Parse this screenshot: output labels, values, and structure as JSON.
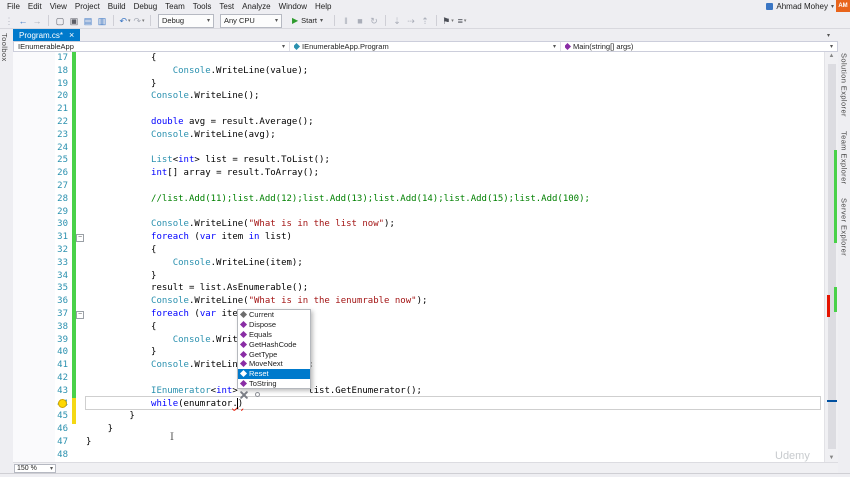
{
  "window": {
    "user": "Ahmad Mohey",
    "avatar_initials": "AM",
    "watermark": "Udemy"
  },
  "menu": {
    "items": [
      "File",
      "Edit",
      "View",
      "Project",
      "Build",
      "Debug",
      "Team",
      "Tools",
      "Test",
      "Analyze",
      "Window",
      "Help"
    ]
  },
  "toolbar": {
    "icons_left": [
      {
        "glyph": "⋮",
        "name": "toolbar-drag-handle-icon",
        "color": "#b0b3bd"
      },
      {
        "glyph": "←",
        "name": "navigate-backward-icon",
        "color": "#3a76c4"
      },
      {
        "glyph": "→",
        "name": "navigate-forward-icon",
        "color": "#a9adb8"
      },
      {
        "sep": true
      },
      {
        "glyph": "▢",
        "name": "new-file-icon",
        "color": "#5a5d66"
      },
      {
        "glyph": "▣",
        "name": "open-file-icon",
        "color": "#5a5d66"
      },
      {
        "glyph": "▤",
        "name": "save-icon",
        "color": "#3a76c4"
      },
      {
        "glyph": "▥",
        "name": "save-all-icon",
        "color": "#3a76c4"
      },
      {
        "sep": true
      },
      {
        "glyph": "↶",
        "name": "undo-icon",
        "color": "#3a76c4",
        "dd": true
      },
      {
        "glyph": "↷",
        "name": "redo-icon",
        "color": "#a9adb8",
        "dd": true
      },
      {
        "sep": true
      }
    ],
    "debug_config": "Debug",
    "platform": "Any CPU",
    "start_label": "Start",
    "icons_right": [
      {
        "sep": true
      },
      {
        "glyph": "‖",
        "name": "pause-icon",
        "color": "#a9adb8"
      },
      {
        "glyph": "■",
        "name": "stop-icon",
        "color": "#a9adb8"
      },
      {
        "glyph": "↻",
        "name": "restart-icon",
        "color": "#a9adb8"
      },
      {
        "sep": true
      },
      {
        "glyph": "⇣",
        "name": "step-into-icon",
        "color": "#a9adb8"
      },
      {
        "glyph": "⇢",
        "name": "step-over-icon",
        "color": "#a9adb8"
      },
      {
        "glyph": "⇡",
        "name": "step-out-icon",
        "color": "#a9adb8"
      },
      {
        "sep": true
      },
      {
        "glyph": "⚑",
        "name": "bookmark-icon",
        "color": "#4a4d55",
        "dd": true
      },
      {
        "glyph": "≡",
        "name": "text-options-icon",
        "color": "#4a4d55",
        "dd": true
      }
    ]
  },
  "tabs": [
    {
      "label": "Program.cs*"
    }
  ],
  "navbar": {
    "project": "IEnumerableApp",
    "type_name": "IEnumerableApp.Program",
    "member": "Main(string[] args)"
  },
  "editor": {
    "zoom": "150 %",
    "lines": [
      {
        "n": 17,
        "s": [
          [
            "p",
            "            {"
          ]
        ]
      },
      {
        "n": 18,
        "s": [
          [
            "p",
            "                "
          ],
          [
            "t",
            "Console"
          ],
          [
            "p",
            ".WriteLine(value);"
          ]
        ]
      },
      {
        "n": 19,
        "s": [
          [
            "p",
            "            }"
          ]
        ]
      },
      {
        "n": 20,
        "s": [
          [
            "p",
            "            "
          ],
          [
            "t",
            "Console"
          ],
          [
            "p",
            ".WriteLine();"
          ]
        ]
      },
      {
        "n": 21,
        "s": []
      },
      {
        "n": 22,
        "s": [
          [
            "p",
            "            "
          ],
          [
            "k",
            "double"
          ],
          [
            "p",
            " avg = result.Average();"
          ]
        ]
      },
      {
        "n": 23,
        "s": [
          [
            "p",
            "            "
          ],
          [
            "t",
            "Console"
          ],
          [
            "p",
            ".WriteLine(avg);"
          ]
        ]
      },
      {
        "n": 24,
        "s": []
      },
      {
        "n": 25,
        "s": [
          [
            "p",
            "            "
          ],
          [
            "t",
            "List"
          ],
          [
            "p",
            "<"
          ],
          [
            "k",
            "int"
          ],
          [
            "p",
            "> list = result.ToList();"
          ]
        ]
      },
      {
        "n": 26,
        "s": [
          [
            "p",
            "            "
          ],
          [
            "k",
            "int"
          ],
          [
            "p",
            "[] array = result.ToArray();"
          ]
        ]
      },
      {
        "n": 27,
        "s": []
      },
      {
        "n": 28,
        "s": [
          [
            "p",
            "            "
          ],
          [
            "c",
            "//list.Add(11);list.Add(12);list.Add(13);list.Add(14);list.Add(15);list.Add(100);"
          ]
        ]
      },
      {
        "n": 29,
        "s": []
      },
      {
        "n": 30,
        "s": [
          [
            "p",
            "            "
          ],
          [
            "t",
            "Console"
          ],
          [
            "p",
            ".WriteLine("
          ],
          [
            "s",
            "\"What is in the list now\""
          ],
          [
            "p",
            ");"
          ]
        ]
      },
      {
        "n": 31,
        "s": [
          [
            "p",
            "            "
          ],
          [
            "k",
            "foreach"
          ],
          [
            "p",
            " ("
          ],
          [
            "k",
            "var"
          ],
          [
            "p",
            " item "
          ],
          [
            "k",
            "in"
          ],
          [
            "p",
            " list)"
          ]
        ]
      },
      {
        "n": 32,
        "s": [
          [
            "p",
            "            {"
          ]
        ]
      },
      {
        "n": 33,
        "s": [
          [
            "p",
            "                "
          ],
          [
            "t",
            "Console"
          ],
          [
            "p",
            ".WriteLine(item);"
          ]
        ]
      },
      {
        "n": 34,
        "s": [
          [
            "p",
            "            }"
          ]
        ]
      },
      {
        "n": 35,
        "s": [
          [
            "p",
            "            result = list.AsEnumerable();"
          ]
        ]
      },
      {
        "n": 36,
        "s": [
          [
            "p",
            "            "
          ],
          [
            "t",
            "Console"
          ],
          [
            "p",
            ".WriteLine("
          ],
          [
            "s",
            "\"What is in the ienumrable now\""
          ],
          [
            "p",
            ");"
          ]
        ]
      },
      {
        "n": 37,
        "s": [
          [
            "p",
            "            "
          ],
          [
            "k",
            "foreach"
          ],
          [
            "p",
            " ("
          ],
          [
            "k",
            "var"
          ],
          [
            "p",
            " ite"
          ]
        ]
      },
      {
        "n": 38,
        "s": [
          [
            "p",
            "            {"
          ]
        ]
      },
      {
        "n": 39,
        "s": [
          [
            "p",
            "                "
          ],
          [
            "t",
            "Console"
          ],
          [
            "p",
            ".Writ"
          ]
        ]
      },
      {
        "n": 40,
        "s": [
          [
            "p",
            "            }"
          ]
        ]
      },
      {
        "n": 41,
        "s": [
          [
            "p",
            "            "
          ],
          [
            "t",
            "Console"
          ],
          [
            "p",
            ".WriteLin            );"
          ]
        ]
      },
      {
        "n": 42,
        "s": []
      },
      {
        "n": 43,
        "s": [
          [
            "p",
            "            "
          ],
          [
            "t",
            "IEnumerator"
          ],
          [
            "p",
            "<"
          ],
          [
            "k",
            "int"
          ],
          [
            "p",
            ">             list.GetEnumerator();"
          ]
        ]
      },
      {
        "n": 44,
        "s": [
          [
            "p",
            "            "
          ],
          [
            "k",
            "while"
          ],
          [
            "p",
            "(enumrator"
          ],
          [
            "e",
            ".)"
          ]
        ]
      },
      {
        "n": 45,
        "s": [
          [
            "p",
            "        }"
          ]
        ]
      },
      {
        "n": 46,
        "s": [
          [
            "p",
            "    }"
          ]
        ]
      },
      {
        "n": 47,
        "s": [
          [
            "p",
            "}"
          ]
        ]
      },
      {
        "n": 48,
        "s": []
      }
    ]
  },
  "completion": {
    "selected": "Reset",
    "items": [
      {
        "label": "Current",
        "kind": "property"
      },
      {
        "label": "Dispose",
        "kind": "method"
      },
      {
        "label": "Equals",
        "kind": "method"
      },
      {
        "label": "GetHashCode",
        "kind": "method"
      },
      {
        "label": "GetType",
        "kind": "method"
      },
      {
        "label": "MoveNext",
        "kind": "method"
      },
      {
        "label": "Reset",
        "kind": "method"
      },
      {
        "label": "ToString",
        "kind": "method"
      }
    ]
  },
  "side_tabs": {
    "left": [
      "Toolbox"
    ],
    "right": [
      "Solution Explorer",
      "Team Explorer",
      "Server Explorer"
    ]
  },
  "colors": {
    "accent": "#007acc",
    "keyword": "#0000ff",
    "type": "#2b91af",
    "string": "#a31515",
    "comment": "#008000",
    "error": "#e51400",
    "change_saved": "#49d149",
    "change_unsaved": "#f4d814"
  }
}
